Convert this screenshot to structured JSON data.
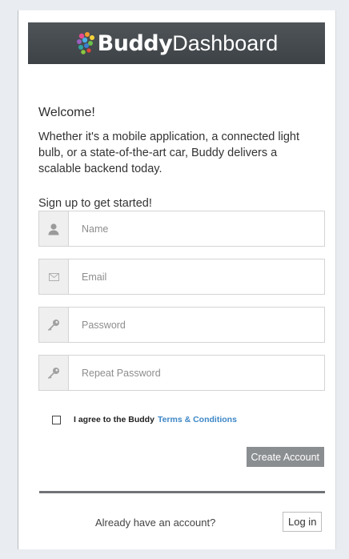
{
  "brand": {
    "bold": "Buddy",
    "light": "Dashboard"
  },
  "welcome": "Welcome!",
  "intro": "Whether it's a mobile application, a connected light bulb, or a state-of-the-art car, Buddy delivers a scalable backend today.",
  "signup_prompt": "Sign up to get started!",
  "fields": {
    "name": {
      "placeholder": "Name",
      "icon": "user-icon"
    },
    "email": {
      "placeholder": "Email",
      "icon": "envelope-icon"
    },
    "password": {
      "placeholder": "Password",
      "icon": "key-icon"
    },
    "repeat_password": {
      "placeholder": "Repeat Password",
      "icon": "key-icon"
    }
  },
  "agree": {
    "text": "I agree to the Buddy",
    "link": "Terms & Conditions",
    "checked": false
  },
  "create_account": "Create Account",
  "already": "Already have an account?",
  "login": "Log in",
  "colors": {
    "header": "#45494d",
    "link": "#3d86c6",
    "button": "#8b8e91"
  }
}
